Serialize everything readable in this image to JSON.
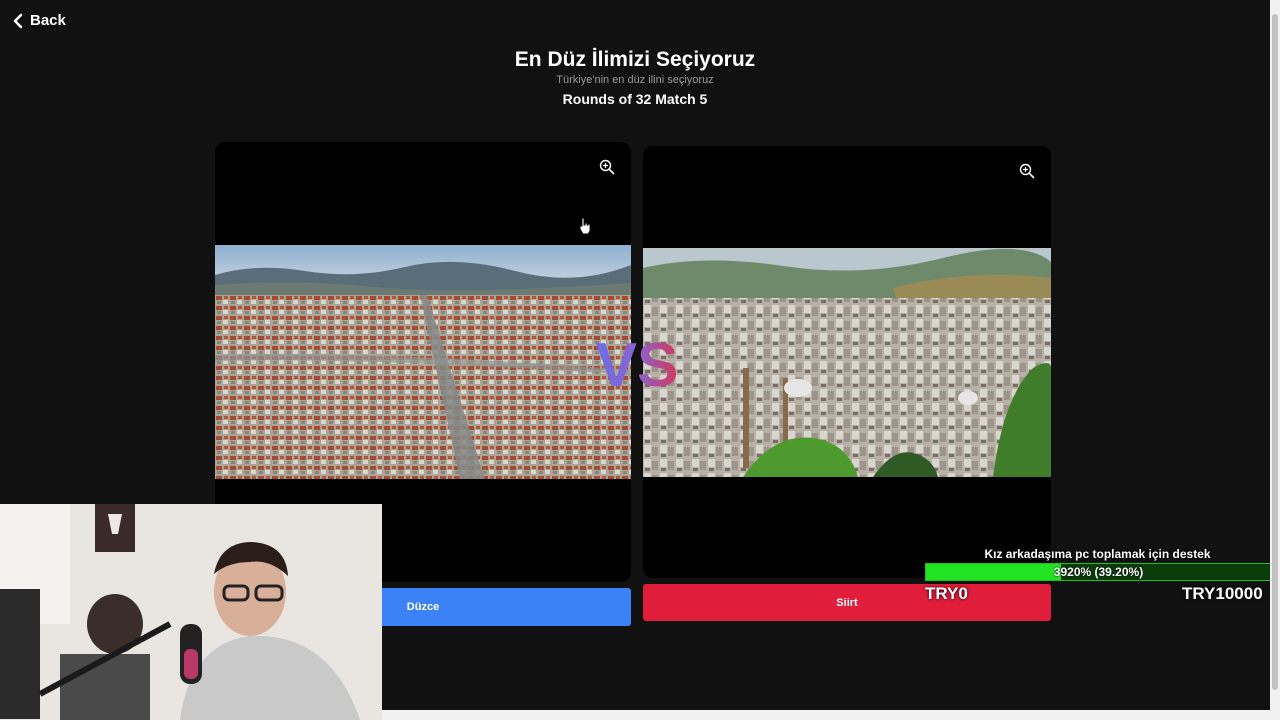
{
  "nav": {
    "back_label": "Back"
  },
  "header": {
    "title": "En Düz İlimizi Seçiyoruz",
    "subtitle": "Türkiye'nin en düz ilini seçiyoruz",
    "round": "Rounds of 32 Match 5"
  },
  "match": {
    "left": {
      "name": "Düzce",
      "color": "#3b82f6"
    },
    "right": {
      "name": "Siirt",
      "color": "#e11d3c"
    },
    "vs_label": "VS"
  },
  "donation": {
    "title": "Kız arkadaşıma pc toplamak için destek",
    "progress_text": "3920% (39.20%)",
    "progress_fraction": 0.392,
    "min_label": "TRY0",
    "max_label": "TRY10000"
  }
}
